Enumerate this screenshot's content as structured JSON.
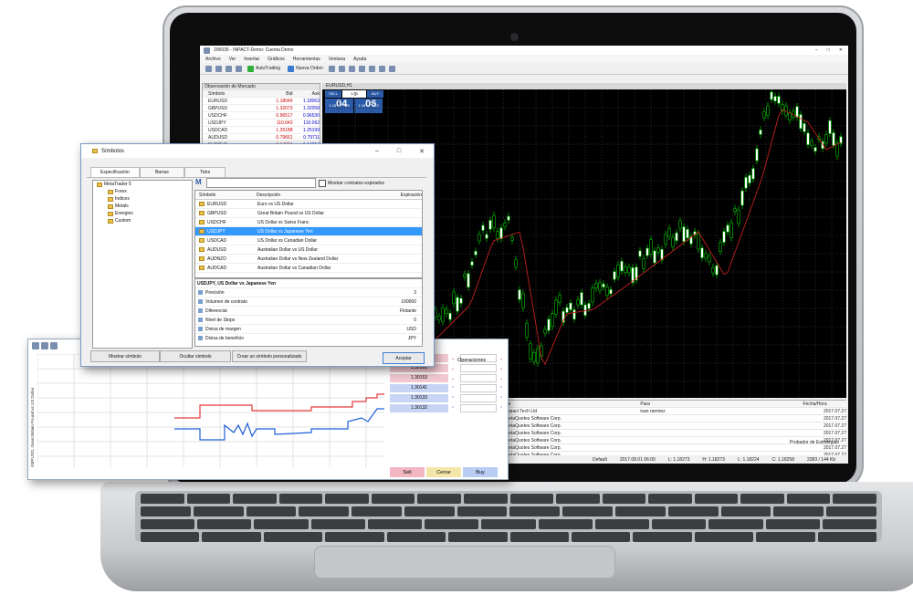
{
  "mt5": {
    "title": "206036 - INPACT-Demo: Cuenta Demo",
    "menu": [
      "Archivo",
      "Ver",
      "Insertar",
      "Gráficos",
      "Herramientas",
      "Ventana",
      "Ayuda"
    ],
    "toolbar": {
      "autotrading": "AutoTrading",
      "nueva_orden": "Nueva Orden"
    },
    "market_watch": {
      "title": "Observación de Mercado",
      "headers": [
        "Símbolo",
        "Bid",
        "Ask"
      ],
      "rows": [
        [
          "EURUSD",
          "1.18049",
          "1.18063"
        ],
        [
          "GBPUSD",
          "1.32073",
          "1.32058"
        ],
        [
          "USDCHF",
          "0.96517",
          "0.96530"
        ],
        [
          "USDJPY",
          "110.043",
          "110.062"
        ],
        [
          "USDCAD",
          "1.25188",
          "1.25199"
        ],
        [
          "AUDUSD",
          "0.79661",
          "0.79711"
        ],
        [
          "EURCHF",
          "1.14031",
          "1.14054"
        ]
      ]
    },
    "chart": {
      "tab": "EURUSD,H1",
      "symbol_tab": "EURUSD,H1",
      "sell_label": "SELL",
      "buy_label": "BUY",
      "volume": "1.00",
      "sell_big": "04",
      "sell_small": "1.18",
      "sell_sup": "8",
      "buy_big": "06",
      "buy_small": "1.18",
      "buy_sup": "3"
    },
    "terminal": {
      "headers": [
        "De",
        "Para",
        "Fecha/Hora"
      ],
      "rows": [
        [
          "Impact Tech Ltd",
          "ivan ramirez",
          "2017.07.27"
        ],
        [
          "MetaQuotes Software Corp.",
          "",
          "2017.07.27"
        ],
        [
          "MetaQuotes Software Corp.",
          "",
          "2017.07.27"
        ],
        [
          "MetaQuotes Software Corp.",
          "",
          "2017.07.27"
        ],
        [
          "MetaQuotes Software Corp.",
          "",
          "2017.07.27"
        ],
        [
          "MetaQuotes Software Corp.",
          "",
          "2017.07.27"
        ],
        [
          "MetaQuotes Software Corp.",
          "",
          "2017.07.27"
        ]
      ],
      "strategy_tester": "Probador de Estrategias"
    },
    "status": [
      "Default",
      "2017.08.01 06:00",
      "L: 1.18273",
      "H: 1.18273",
      "L: 1.18224",
      "C: 1.18258",
      "2383 / 144 Kb"
    ]
  },
  "dialog": {
    "title": "Símbolos",
    "tabs": [
      "Especificación",
      "Barras",
      "Ticks"
    ],
    "tree": [
      "MetaTrader 5",
      "Forex",
      "Indices",
      "Metals",
      "Energies",
      "Custom"
    ],
    "show_expired": "Mostrar contratos expirados",
    "table_headers": [
      "Símbolo",
      "Descripción",
      "Expiración"
    ],
    "symbols": [
      [
        "EURUSD",
        "Euro vs US Dollar"
      ],
      [
        "GBPUSD",
        "Great Britain Pound vs US Dollar"
      ],
      [
        "USDCHF",
        "US Dollar vs Swiss Franc"
      ],
      [
        "USDJPY",
        "US Dollar vs Japanese Yen"
      ],
      [
        "USDCAD",
        "US Dollar vs Canadian Dollar"
      ],
      [
        "AUDUSD",
        "Australian Dollar vs US Dollar"
      ],
      [
        "AUDNZD",
        "Australian Dollar vs New Zealand Dollar"
      ],
      [
        "AUDCAD",
        "Australian Dollar vs Canadian Dollar"
      ]
    ],
    "selected_index": 3,
    "props_title": "USDJPY, US Dollar vs Japanese Yen",
    "props": [
      [
        "Precisión",
        "3"
      ],
      [
        "Volumen de contrato",
        "100000"
      ],
      [
        "Diferencial",
        "Flotante"
      ],
      [
        "Nivel de Stops",
        "0"
      ],
      [
        "Divisa de margen",
        "USD"
      ],
      [
        "Divisa de beneficio",
        "JPY"
      ]
    ],
    "buttons": {
      "show": "Mostrar símbolo",
      "hide": "Ocultar símbolo",
      "create": "Crear un símbolo personalizado",
      "ok": "Aceptar"
    }
  },
  "dom": {
    "ylabel": "GBPUSD, Great Britain Pound vs US Dollar",
    "operations": "Operaciones",
    "prices": [
      "1.30162",
      "1.30161",
      "1.30153",
      "1.30141",
      "1.30133",
      "1.30132"
    ],
    "sell": "Sell",
    "close": "Cerrar",
    "buy": "Buy",
    "colors": {
      "ask": "#e23b3b",
      "bid": "#1f5fd6",
      "sell_bg": "#f3b6c3",
      "close_bg": "#f3e6a8",
      "buy_bg": "#b9ccf4"
    }
  }
}
